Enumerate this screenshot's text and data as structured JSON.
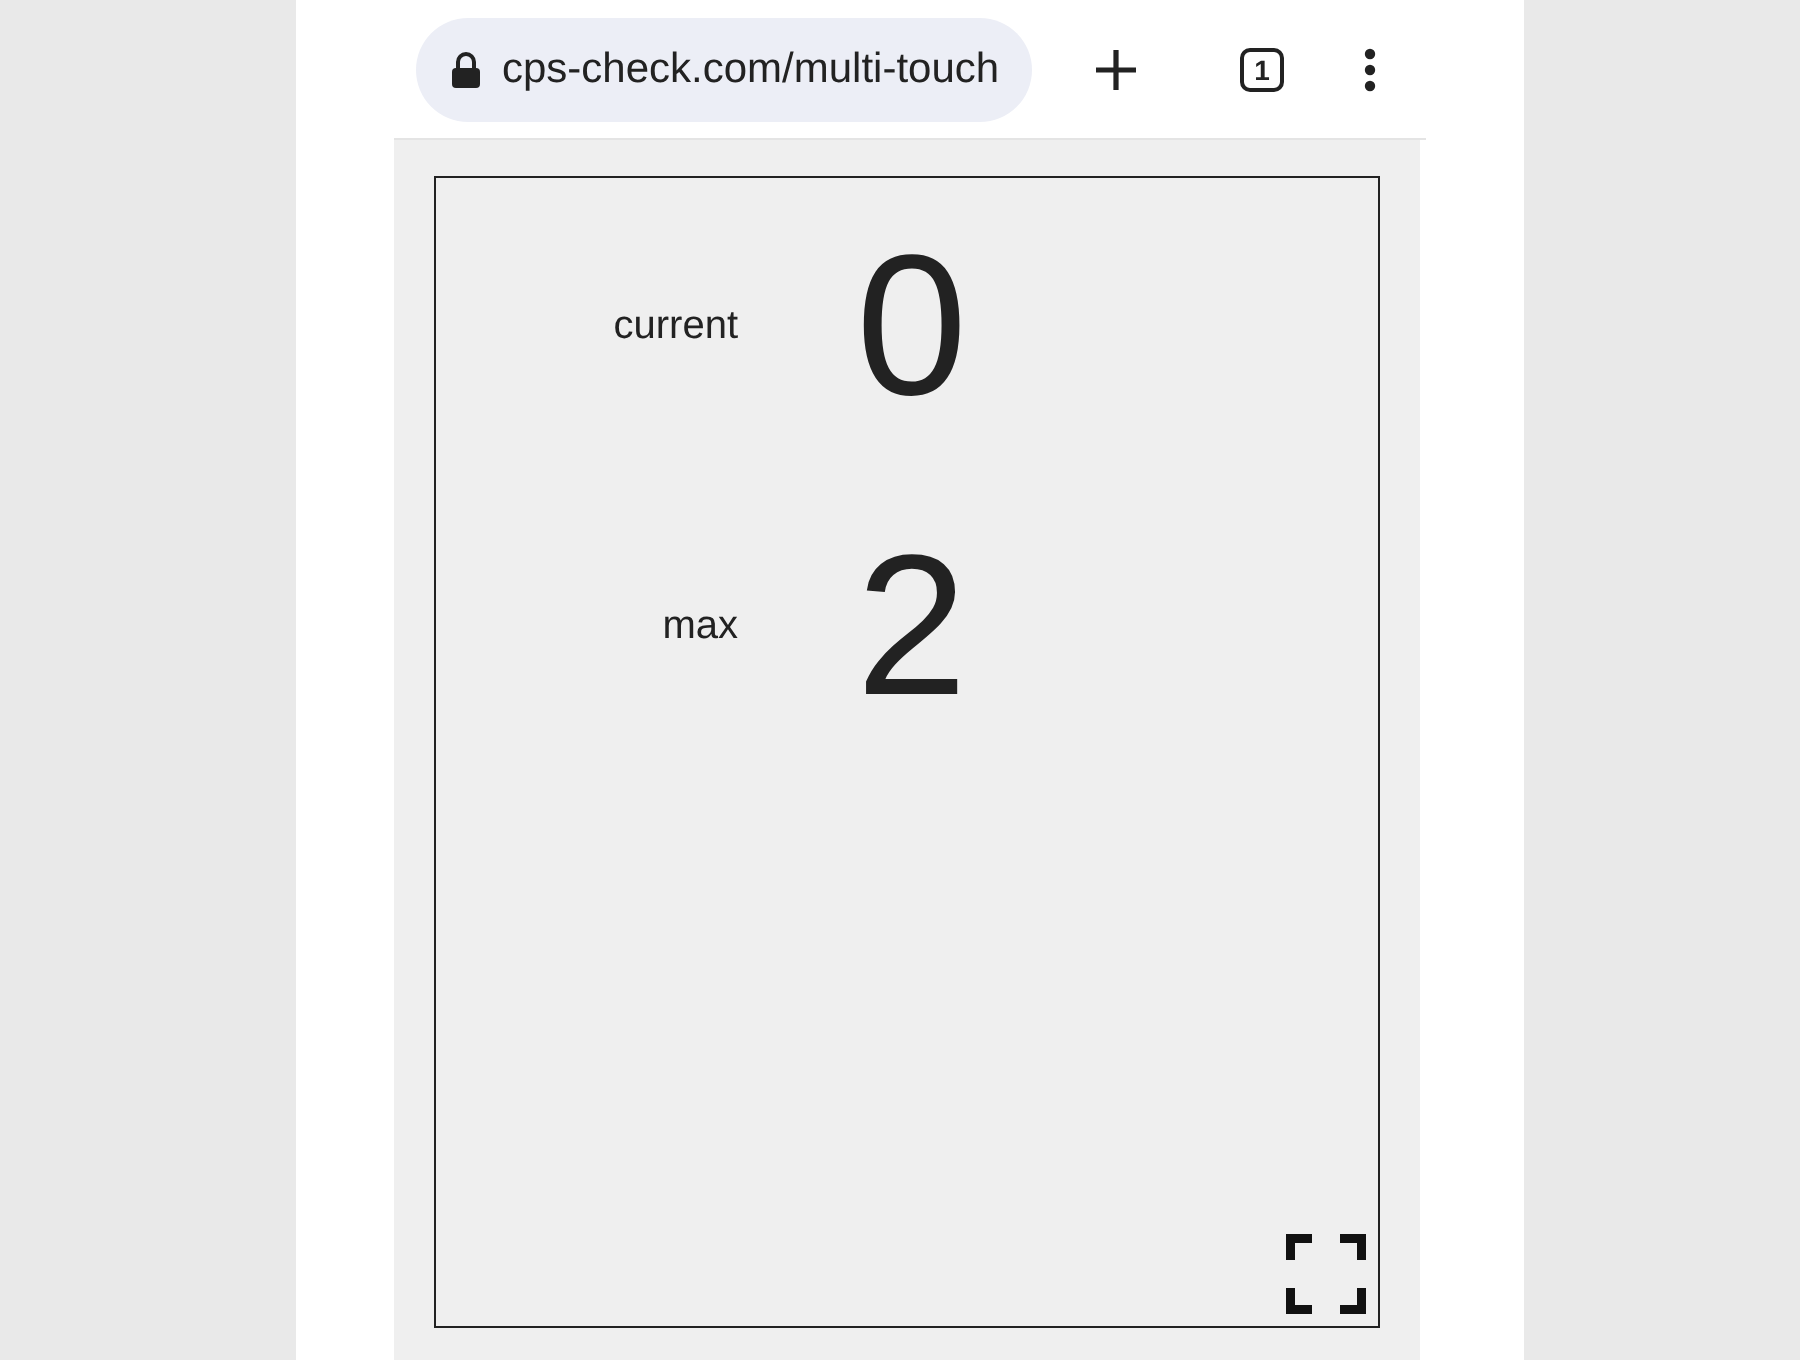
{
  "address_bar": {
    "url": "cps-check.com/multi-touch",
    "tab_count": "1"
  },
  "counters": [
    {
      "label": "current",
      "value": "0"
    },
    {
      "label": "max",
      "value": "2"
    }
  ]
}
